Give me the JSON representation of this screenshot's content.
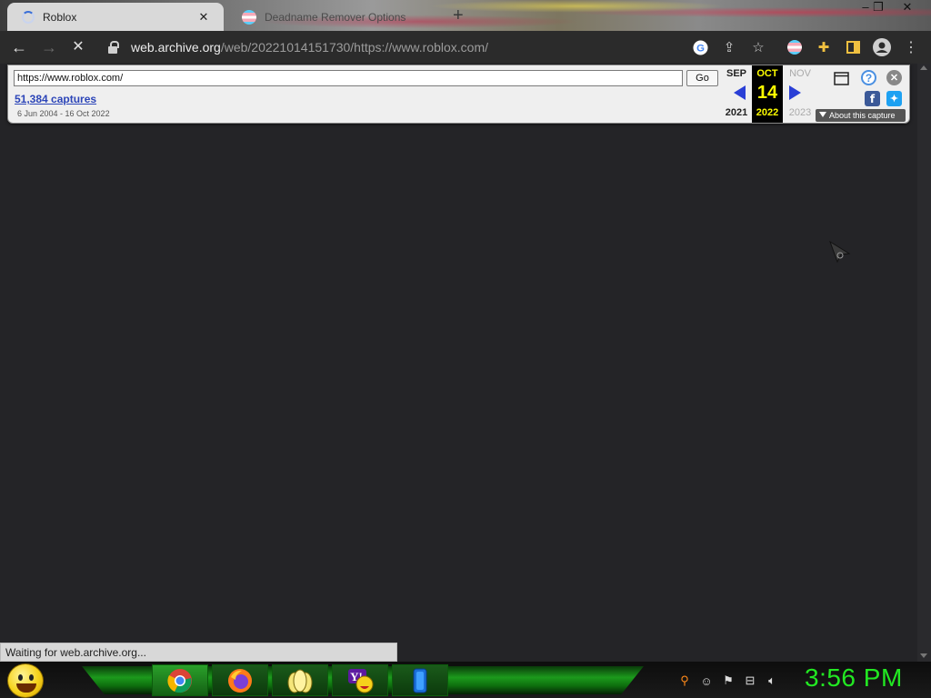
{
  "browser": {
    "tabs": [
      {
        "title": "Roblox",
        "state": "loading"
      },
      {
        "title": "Deadname Remover Options",
        "state": "inactive"
      }
    ],
    "url_host": "web.archive.org",
    "url_path": "/web/20221014151730/https://www.roblox.com/",
    "status_text": "Waiting for web.archive.org..."
  },
  "wayback": {
    "url_value": "https://www.roblox.com/",
    "go_label": "Go",
    "captures_label": "51,384 captures",
    "date_range": "6 Jun 2004 - 16 Oct 2022",
    "prev_month": "SEP",
    "cur_month": "OCT",
    "next_month": "NOV",
    "cur_day": "14",
    "prev_year": "2021",
    "cur_year": "2022",
    "next_year": "2023",
    "about_label": "About this capture",
    "colors": {
      "arrow": "#2a3fd6",
      "current_highlight": "#ffff00",
      "facebook": "#3b5998",
      "twitter": "#1da1f2"
    }
  },
  "taskbar": {
    "apps": [
      "chrome-icon",
      "firefox-icon",
      "file-explorer-icon",
      "yahoo-messenger-icon",
      "blue-app-icon"
    ],
    "clock": "3:56 PM",
    "accent_color": "#22e822"
  }
}
